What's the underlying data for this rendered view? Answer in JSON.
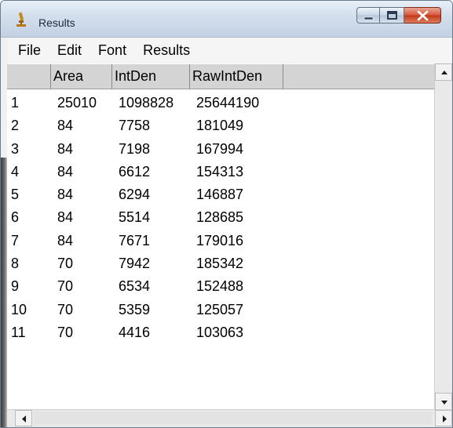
{
  "window": {
    "title": "Results",
    "icon": "microscope-icon",
    "controls": [
      "minimize-icon",
      "maximize-icon",
      "close-icon"
    ]
  },
  "menu": [
    "File",
    "Edit",
    "Font",
    "Results"
  ],
  "table": {
    "columns": [
      "",
      "Area",
      "IntDen",
      "RawIntDen",
      ""
    ],
    "rows": [
      [
        "1",
        "25010",
        "1098828",
        "25644190"
      ],
      [
        "2",
        "84",
        "7758",
        "181049"
      ],
      [
        "3",
        "84",
        "7198",
        "167994"
      ],
      [
        "4",
        "84",
        "6612",
        "154313"
      ],
      [
        "5",
        "84",
        "6294",
        "146887"
      ],
      [
        "6",
        "84",
        "5514",
        "128685"
      ],
      [
        "7",
        "84",
        "7671",
        "179016"
      ],
      [
        "8",
        "70",
        "7942",
        "185342"
      ],
      [
        "9",
        "70",
        "6534",
        "152488"
      ],
      [
        "10",
        "70",
        "5359",
        "125057"
      ],
      [
        "11",
        "70",
        "4416",
        "103063"
      ]
    ]
  },
  "colors": {
    "header_bg": "#d4d4d4",
    "close_button": "#c43718",
    "titlebar": "#d3deec"
  }
}
